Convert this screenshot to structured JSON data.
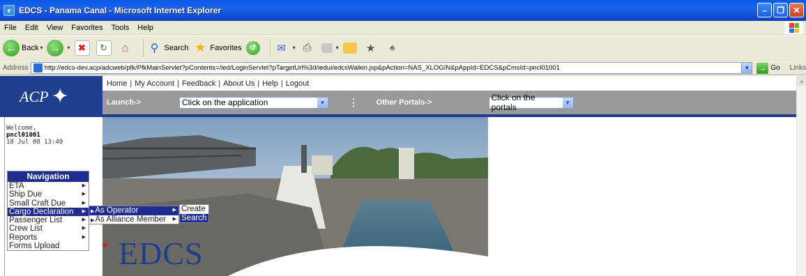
{
  "window": {
    "title": "EDCS - Panama Canal - Microsoft Internet Explorer",
    "app_icon": "e"
  },
  "menubar": [
    "File",
    "Edit",
    "View",
    "Favorites",
    "Tools",
    "Help"
  ],
  "toolbar": {
    "back": "Back",
    "search": "Search",
    "favorites": "Favorites"
  },
  "address": {
    "label": "Address",
    "url": "http://edcs-dev.acp/adcweb/pfk/PfkMainServlet?pContents=/ied/LoginServlet?pTargetUrl%3d/iedui/edcsWalkin.jsp&pAction=NAS_XLOGIN&pAppId=EDCS&pCmsId=pncl01001",
    "go": "Go",
    "links": "Links"
  },
  "header": {
    "logo_text": "ACP",
    "logo_symbol": "✦",
    "topnav": [
      "Home",
      "My Account",
      "Feedback",
      "About Us",
      "Help",
      "Logout"
    ],
    "launch_label": "Launch->",
    "launch_select": "Click on the application",
    "other_portals_label": "Other Portals->",
    "portals_select": "Click on the portals"
  },
  "welcome": {
    "greeting": "Welcome,",
    "user": "pncl01001",
    "timestamp": "18 Jul 08 13:49"
  },
  "navigation": {
    "title": "Navigation",
    "items": [
      {
        "label": "ETA",
        "submenu": true
      },
      {
        "label": "Ship Due",
        "submenu": true
      },
      {
        "label": "Small Craft Due",
        "submenu": true
      },
      {
        "label": "Cargo Declaration",
        "submenu": true,
        "active": true
      },
      {
        "label": "Passenger List",
        "submenu": true
      },
      {
        "label": "Crew List",
        "submenu": true
      },
      {
        "label": "Reports",
        "submenu": true
      },
      {
        "label": "Forms Upload",
        "submenu": false
      }
    ],
    "cargo_submenu": [
      {
        "label": "As Operator",
        "active": true
      },
      {
        "label": "As Alliance Member",
        "active": false
      }
    ],
    "operator_submenu": [
      {
        "label": "Create",
        "active": false
      },
      {
        "label": "Search",
        "active": true
      }
    ]
  },
  "brand": {
    "edcs": "EDCS"
  },
  "colors": {
    "navy": "#1f3e8e",
    "menu_highlight": "#1f2c8f",
    "grey_bar": "#9a9a9a"
  }
}
